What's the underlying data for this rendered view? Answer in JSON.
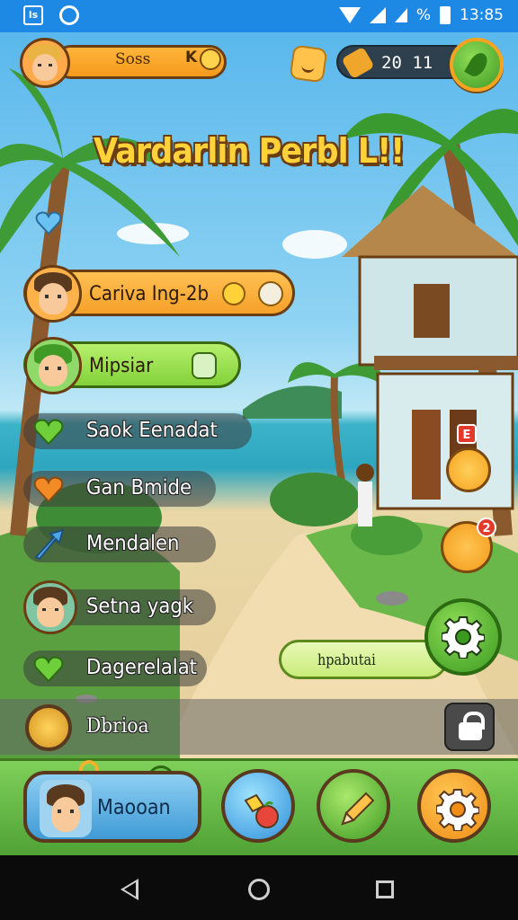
{
  "status_bar": {
    "time": "13:85",
    "battery": "%",
    "icons": [
      "app-icon",
      "sync-icon",
      "wifi-icon",
      "signal-icon",
      "battery-icon"
    ]
  },
  "hud": {
    "player_score": "Soss",
    "player_level": "K",
    "currency_value": "20 11",
    "title": "Vardarlin Perbl L!!"
  },
  "menu": {
    "primary": {
      "label": "Cariva Ing-2b",
      "icons": [
        "coin-icon",
        "shield-icon"
      ]
    },
    "secondary": {
      "label": "Mipsiar",
      "icons": [
        "toggle-icon"
      ]
    },
    "items": [
      {
        "label": "Saok Eenadat",
        "icon": "green-heart-icon",
        "color": "#6fcf3a"
      },
      {
        "label": "Gan Bmide",
        "icon": "orange-heart-icon",
        "color": "#f28a26"
      },
      {
        "label": "Mendalen",
        "icon": "arrow-icon",
        "color": "#4aa6e8"
      },
      {
        "label": "Setna yagk",
        "icon": "avatar-icon",
        "color": "#7fc6a2"
      },
      {
        "label": "Dagerelalat",
        "icon": "green-heart-icon",
        "color": "#6fcf3a"
      }
    ],
    "about_label": "Dbrioa"
  },
  "side": {
    "badge_1": "E",
    "badge_2": "2",
    "hint_label": "hpabutai"
  },
  "bottom_nav": {
    "profile_label": "Maooan",
    "buttons": [
      "shop-icon",
      "pencil-icon",
      "gear-icon"
    ]
  },
  "colors": {
    "accent_orange": "#f5a12a",
    "accent_green": "#83d23a",
    "sky": "#5ab8ec",
    "outline": "#6b3d12"
  }
}
